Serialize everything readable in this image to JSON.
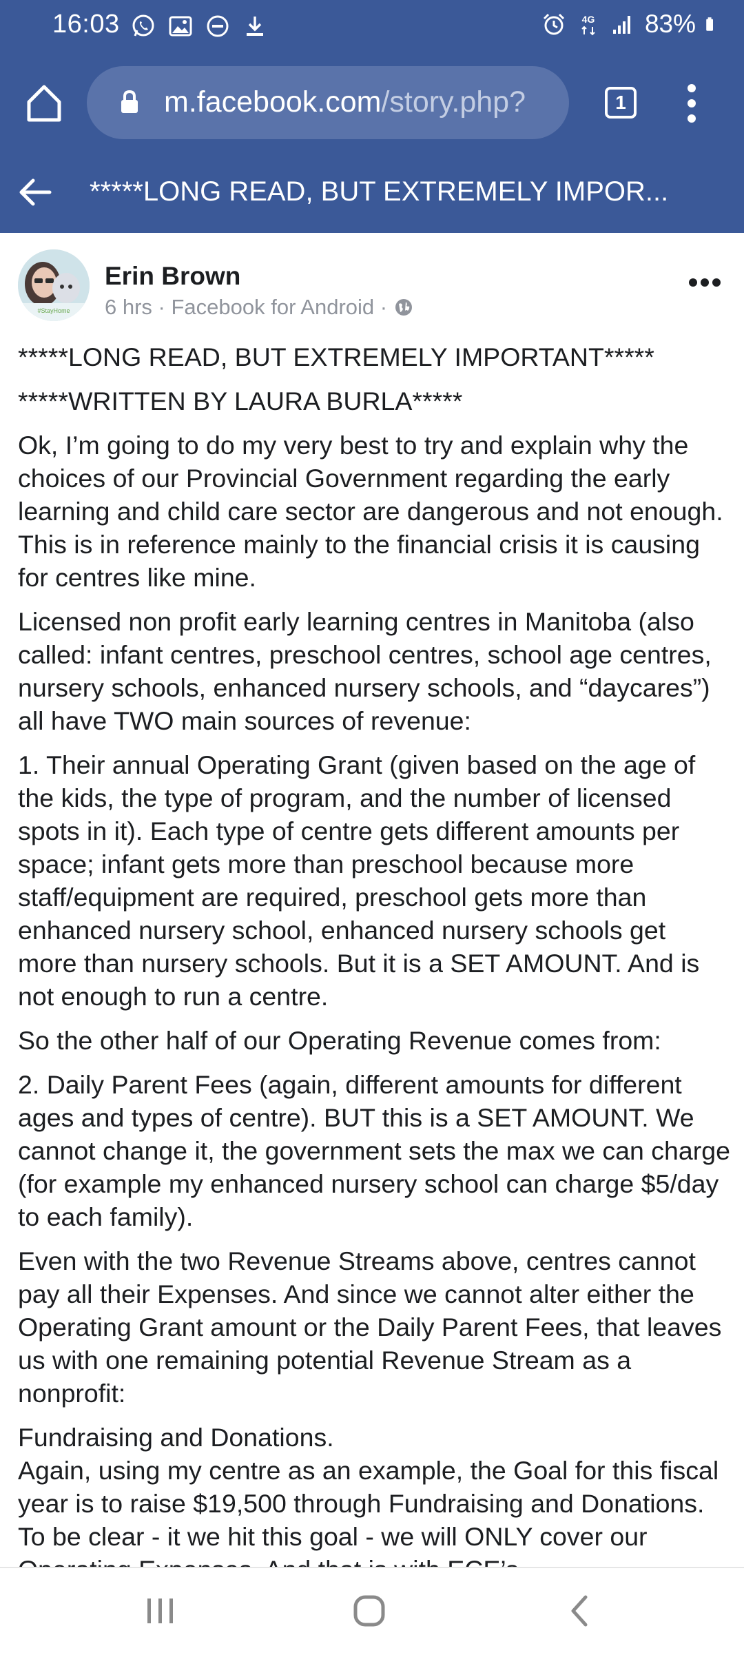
{
  "status_bar": {
    "time": "16:03",
    "battery": "83%",
    "network": "4G",
    "left_icons": [
      "whatsapp-icon",
      "gallery-icon",
      "do-not-disturb-icon",
      "download-icon"
    ],
    "right_icons": [
      "alarm-icon",
      "network-4g-icon",
      "signal-icon",
      "battery-icon"
    ]
  },
  "browser": {
    "url_host": "m.facebook.com",
    "url_path": "/story.php?",
    "tab_count": "1"
  },
  "page": {
    "title": "*****LONG READ, BUT EXTREMELY IMPOR..."
  },
  "post": {
    "author": "Erin Brown",
    "meta": "6 hrs · Facebook for Android ·",
    "avatar_caption": "#StayHome",
    "paragraphs": [
      "*****LONG READ, BUT EXTREMELY IMPORTANT*****",
      "*****WRITTEN BY LAURA BURLA*****",
      "Ok, I’m going to do my very best to try and explain why the choices of our Provincial Government regarding the early learning and child care sector are dangerous and not enough. This is in reference mainly to the financial crisis it is causing for centres like mine.",
      "Licensed non profit early learning centres in Manitoba (also called: infant centres, preschool centres, school age centres, nursery schools, enhanced nursery schools, and “daycares”) all have TWO main sources of revenue:",
      "1. Their annual Operating Grant (given based on the age of the kids, the type of program, and the number of licensed spots in it). Each type of centre gets different amounts per space; infant gets more than preschool because more staff/equipment are required, preschool gets more than enhanced nursery school, enhanced nursery schools get more than nursery schools. But it is a SET AMOUNT. And is not enough to run a centre.",
      "So the other half of our Operating Revenue comes from:",
      "2. Daily Parent Fees (again, different amounts for different ages and types of centre). BUT this is a SET AMOUNT. We cannot change it, the government sets the max we can charge (for example my enhanced nursery school can charge $5/day to each family).",
      "Even with the two Revenue Streams above, centres cannot pay all their Expenses. And since we cannot alter either the Operating Grant amount or the Daily Parent Fees, that leaves us with one remaining potential Revenue Stream as a nonprofit:",
      "Fundraising and Donations.",
      "Again, using my centre as an example, the Goal for this fiscal year is to raise $19,500 through Fundraising and Donations. To be clear - it we hit this goal - we will ONLY cover our Operating Expenses. And that is with ECE’s"
    ]
  },
  "colors": {
    "facebook_blue": "#3b5998",
    "url_pill": "#5a73aa",
    "meta_gray": "#90949c"
  }
}
